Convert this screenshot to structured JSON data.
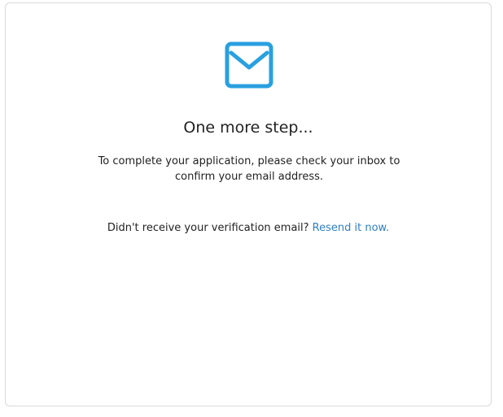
{
  "card": {
    "icon": "envelope-icon",
    "accent_color": "#29a0e0",
    "link_color": "#2f7fc4",
    "title": "One more step...",
    "message": "To complete your application, please check your inbox to confirm your email address.",
    "resend_prompt": "Didn't receive your verification email?",
    "resend_link": "Resend it now."
  }
}
